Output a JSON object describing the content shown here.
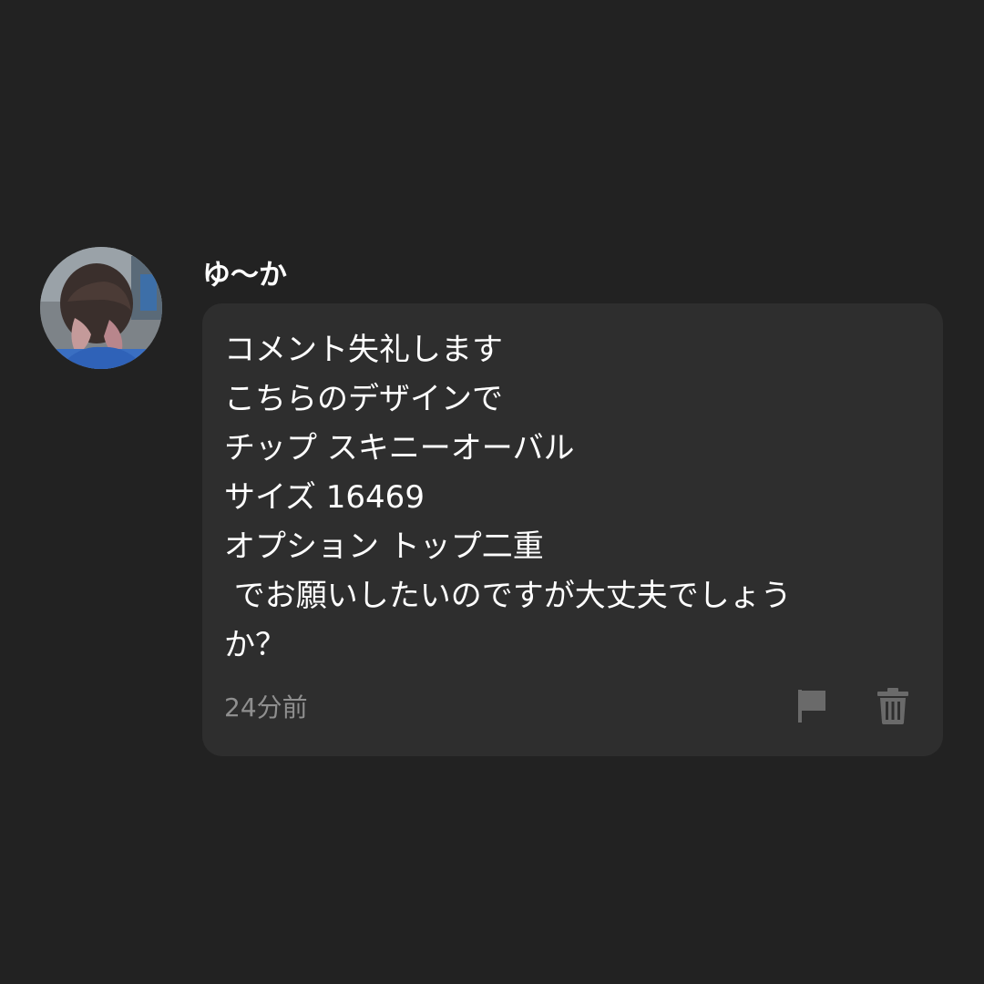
{
  "comment": {
    "author": "ゆ〜か",
    "avatar": "avatar-photo",
    "message_lines": [
      "コメント失礼します",
      "こちらのデザインで",
      "チップ スキニーオーバル",
      "サイズ 16469",
      "オプション トップ二重",
      " でお願いしたいのですが大丈夫でしょう",
      "か？"
    ],
    "time": "24分前",
    "actions": {
      "report_icon": "flag-icon",
      "delete_icon": "trash-icon"
    }
  },
  "colors": {
    "background": "#222222",
    "bubble": "#2e2e2e",
    "text": "#ffffff",
    "muted": "#8f8f8f",
    "icon": "#6a6a6a"
  }
}
